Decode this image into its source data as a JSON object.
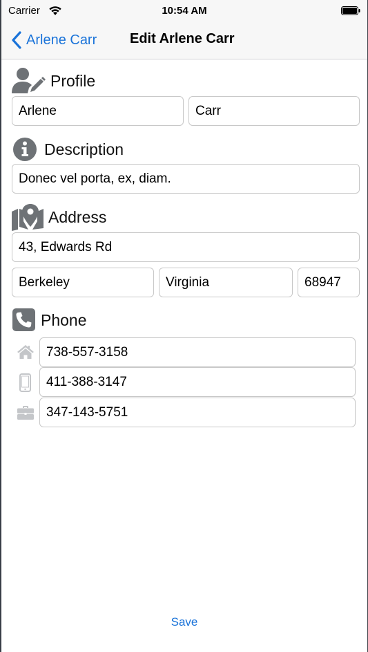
{
  "status_bar": {
    "carrier": "Carrier",
    "time": "10:54 AM"
  },
  "nav": {
    "back_label": "Arlene Carr",
    "title": "Edit Arlene Carr"
  },
  "profile": {
    "title": "Profile",
    "first_name": "Arlene",
    "last_name": "Carr"
  },
  "description": {
    "title": "Description",
    "text": "Donec vel porta, ex, diam."
  },
  "address": {
    "title": "Address",
    "street": "43, Edwards Rd",
    "city": "Berkeley",
    "state": "Virginia",
    "zip": "68947"
  },
  "phone": {
    "title": "Phone",
    "home": "738-557-3158",
    "mobile": "411-388-3147",
    "work": "347-143-5751"
  },
  "actions": {
    "save_label": "Save"
  },
  "colors": {
    "accent": "#1a73d9",
    "section_icon": "#6e7276",
    "phone_type_icon": "#c4c6c9",
    "field_border": "#c8c8c8",
    "bar_background": "#f7f7f7"
  },
  "icons": {
    "wifi": "wifi-icon",
    "battery": "battery-icon",
    "back": "chevron-left-icon",
    "profile": "user-edit-icon",
    "description": "info-circle-icon",
    "address": "map-marker-icon",
    "phone": "phone-square-icon",
    "home": "home-icon",
    "mobile": "mobile-icon",
    "work": "briefcase-icon"
  }
}
